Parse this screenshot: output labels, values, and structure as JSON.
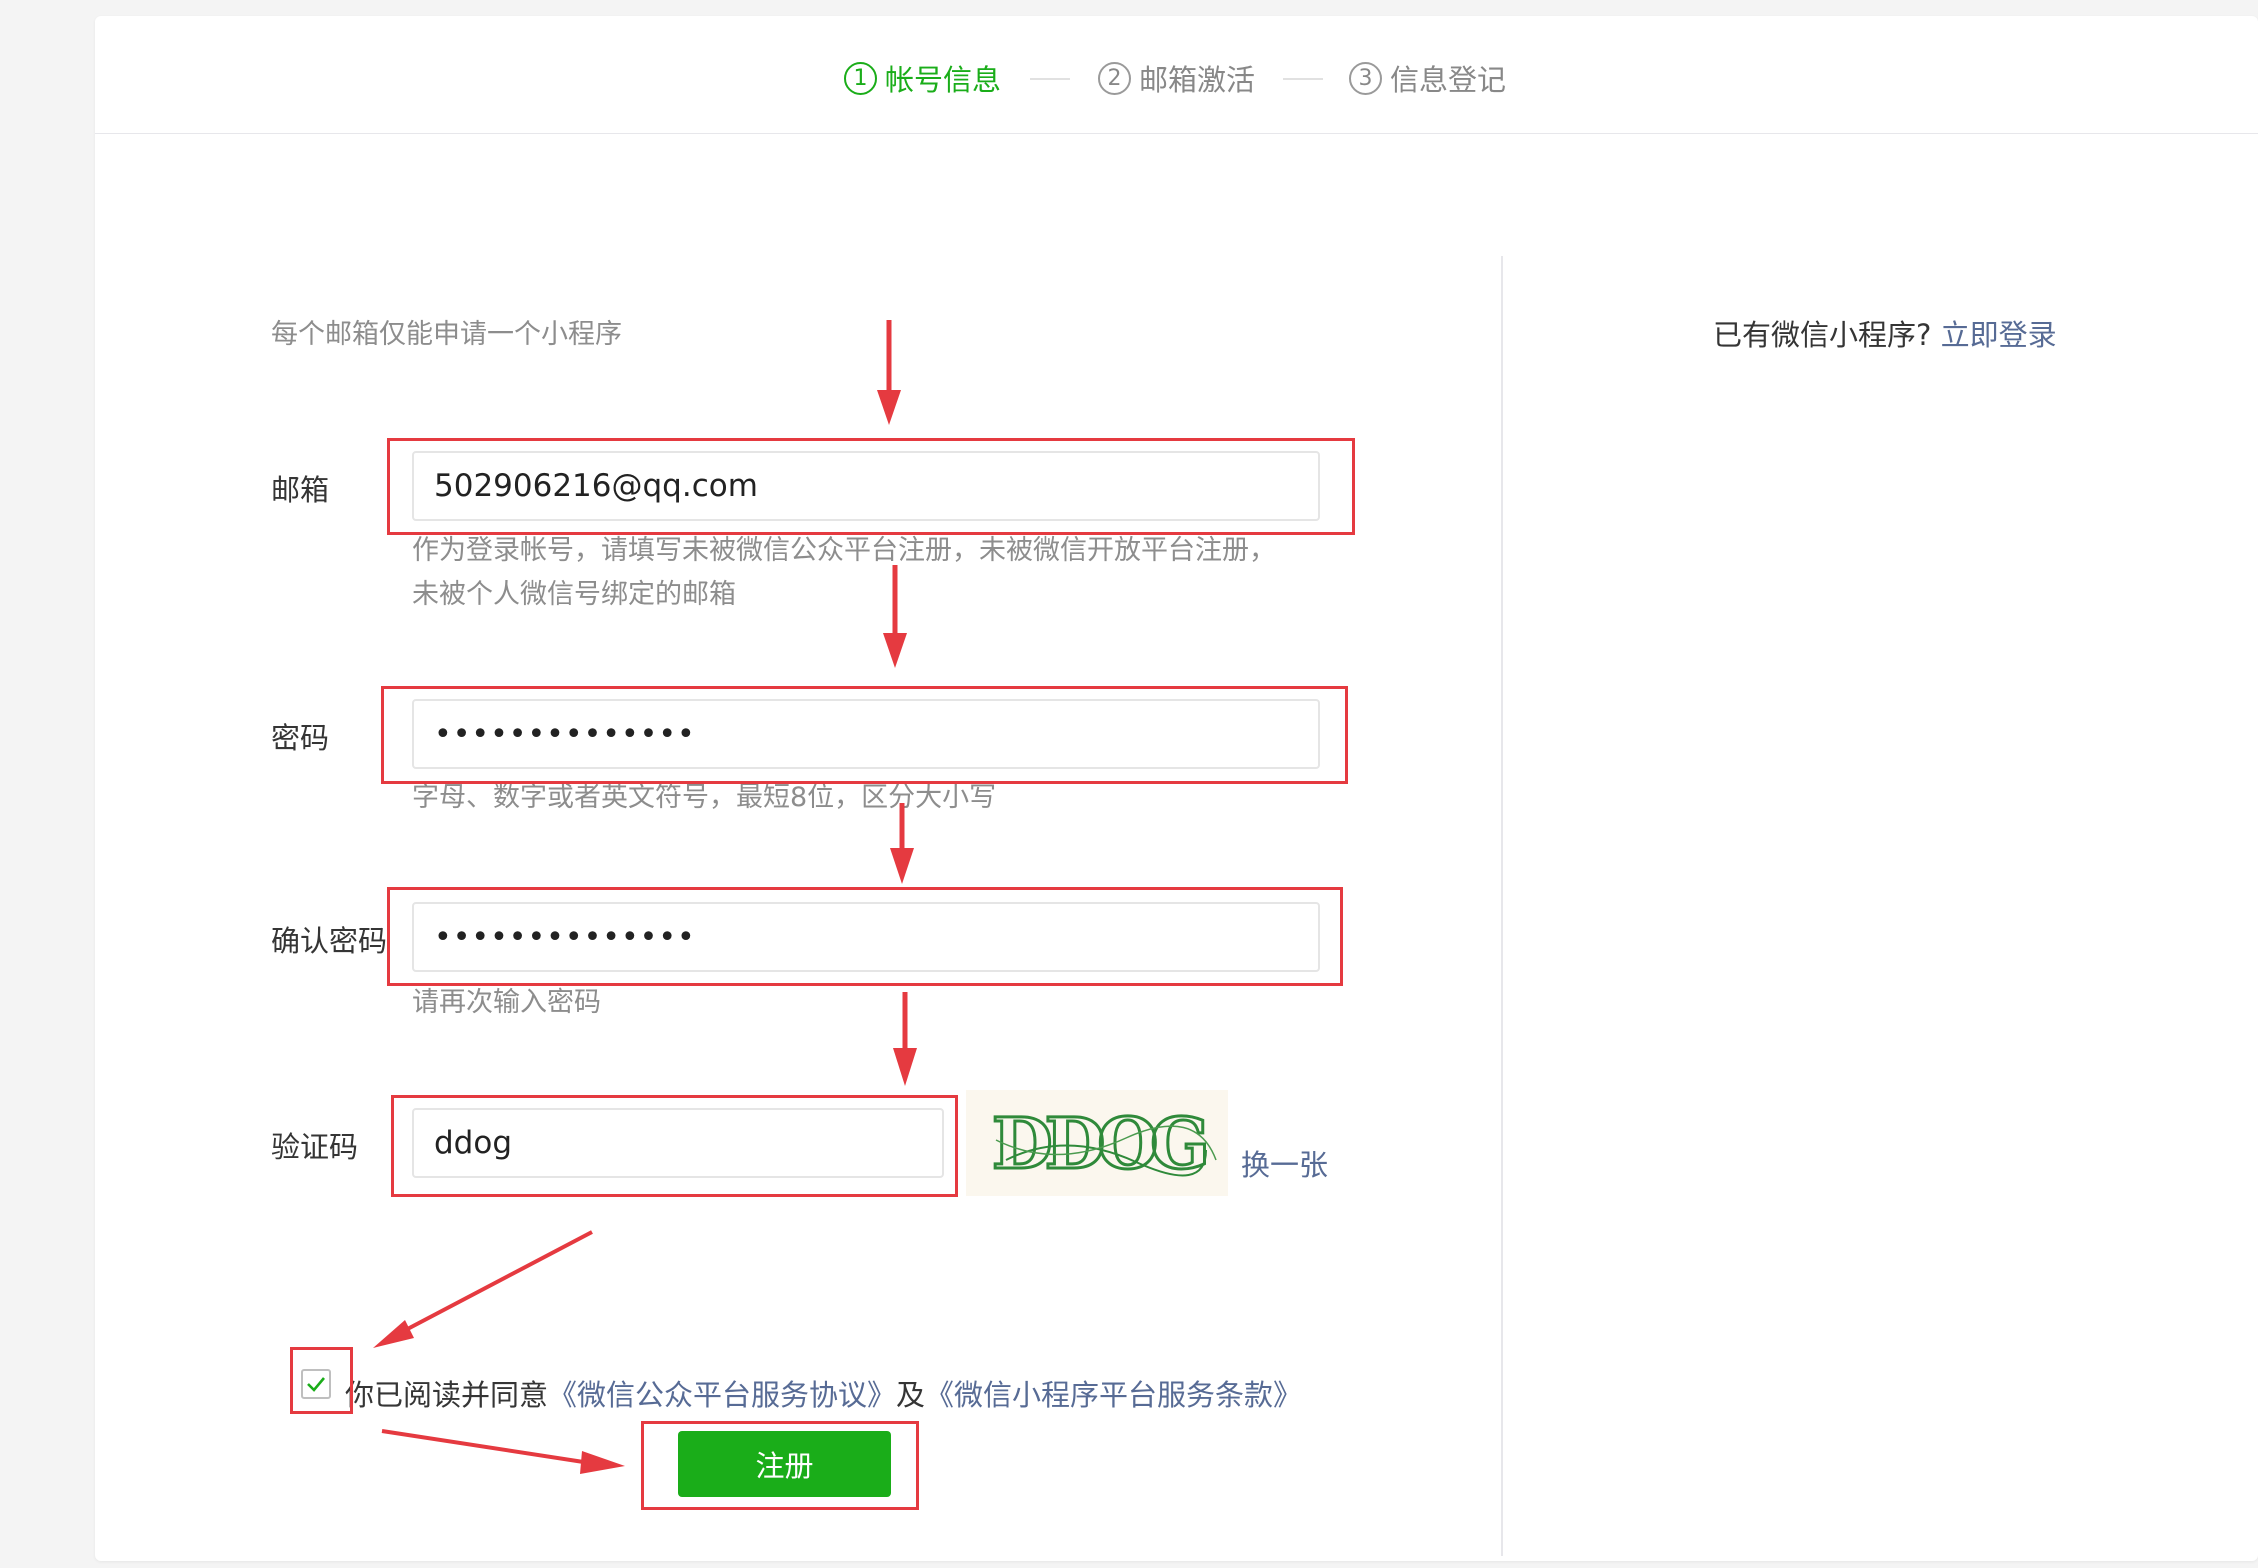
{
  "steps": [
    {
      "num": "1",
      "label": "帐号信息",
      "active": true
    },
    {
      "num": "2",
      "label": "邮箱激活",
      "active": false
    },
    {
      "num": "3",
      "label": "信息登记",
      "active": false
    }
  ],
  "intro": "每个邮箱仅能申请一个小程序",
  "login_hint": {
    "text": "已有微信小程序?",
    "link": "立即登录"
  },
  "fields": {
    "email": {
      "label": "邮箱",
      "value": "502906216@qq.com",
      "tip_line1": "作为登录帐号，请填写未被微信公众平台注册，未被微信开放平台注册，",
      "tip_line2": "未被个人微信号绑定的邮箱"
    },
    "password": {
      "label": "密码",
      "value": "••••••••••••••",
      "tip": "字母、数字或者英文符号，最短8位，区分大小写"
    },
    "confirm": {
      "label": "确认密码",
      "value": "••••••••••••••",
      "tip": "请再次输入密码"
    },
    "captcha": {
      "label": "验证码",
      "value": "ddog",
      "image_text": "DDOG",
      "change_label": "换一张"
    }
  },
  "agreement": {
    "prefix": "你已阅读并同意",
    "link1": "《微信公众平台服务协议》",
    "middle": "及",
    "link2": "《微信小程序平台服务条款》",
    "checked": true
  },
  "submit_label": "注册",
  "colors": {
    "accent": "#1aad19",
    "link": "#576b95",
    "annotation": "#e53a40"
  }
}
